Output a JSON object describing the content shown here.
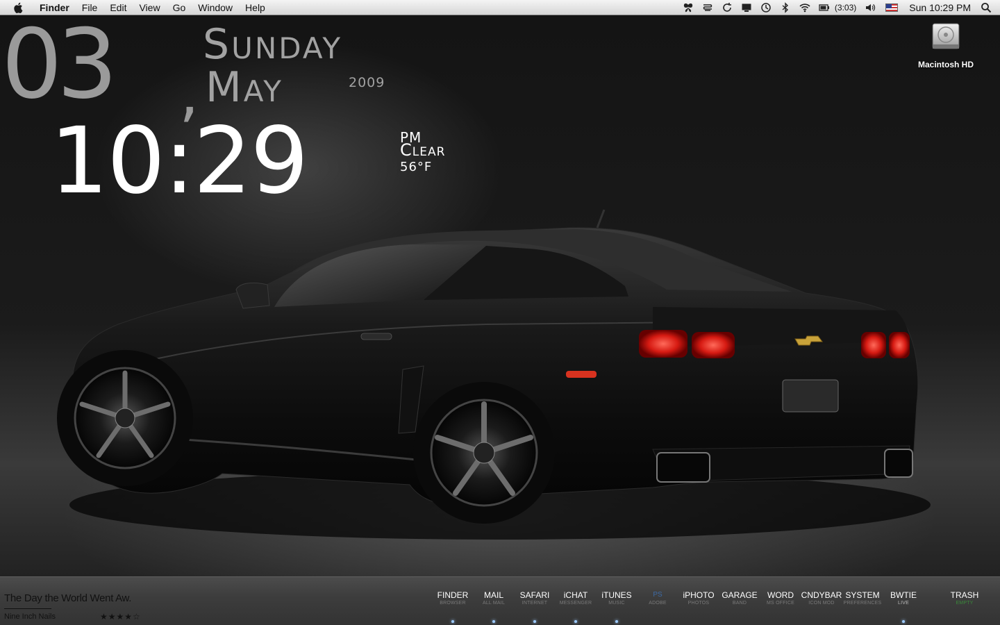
{
  "menubar": {
    "app_name": "Finder",
    "items": [
      "File",
      "Edit",
      "View",
      "Go",
      "Window",
      "Help"
    ],
    "battery": "(3:03)",
    "clock": "Sun 10:29 PM",
    "status_icons": [
      "butterfly-icon",
      "scripts-icon",
      "sync-icon",
      "display-icon",
      "time-machine-icon",
      "bluetooth-icon",
      "wifi-icon",
      "battery-icon",
      "volume-icon",
      "us-flag-icon",
      "spotlight-icon"
    ]
  },
  "widget": {
    "day_number": "03",
    "comma": ",",
    "weekday": "Sunday",
    "month": "May",
    "year": "2009",
    "time": "10:29",
    "ampm": "PM",
    "condition": "Clear",
    "temperature": "56°F"
  },
  "desktop": {
    "volume_label": "Macintosh HD"
  },
  "now_playing": {
    "title": "The Day the World Went Aw.",
    "artist": "Nine Inch Nails",
    "rating": "★★★★☆"
  },
  "dock": {
    "items": [
      {
        "name": "FINDER",
        "sub": "BROWSER",
        "running": true
      },
      {
        "name": "MAIL",
        "sub": "ALL MAIL",
        "running": true
      },
      {
        "name": "SAFARI",
        "sub": "INTERNET",
        "running": true
      },
      {
        "name": "iCHAT",
        "sub": "MESSENGER",
        "running": true
      },
      {
        "name": "iTUNES",
        "sub": "MUSIC",
        "running": true
      },
      {
        "name": "PS",
        "sub": "ADOBE",
        "running": false
      },
      {
        "name": "iPHOTO",
        "sub": "PHOTOS",
        "running": false
      },
      {
        "name": "GARAGE",
        "sub": "BAND",
        "running": false
      },
      {
        "name": "WORD",
        "sub": "MS OFFICE",
        "running": false
      },
      {
        "name": "CNDYBAR",
        "sub": "ICON MOD",
        "running": false
      },
      {
        "name": "SYSTEM",
        "sub": "PREFERENCES",
        "running": false
      },
      {
        "name": "BWTIE",
        "sub": "LIVE",
        "running": true
      }
    ],
    "trash": {
      "name": "TRASH",
      "sub": "EMPTY"
    }
  },
  "colors": {
    "menubar": "#e6e6e6",
    "widget_gray": "#a2a2a2",
    "dock_bg": "#3d3d3d",
    "running_dot": "#9ecbff",
    "taillight": "#e0231c"
  }
}
